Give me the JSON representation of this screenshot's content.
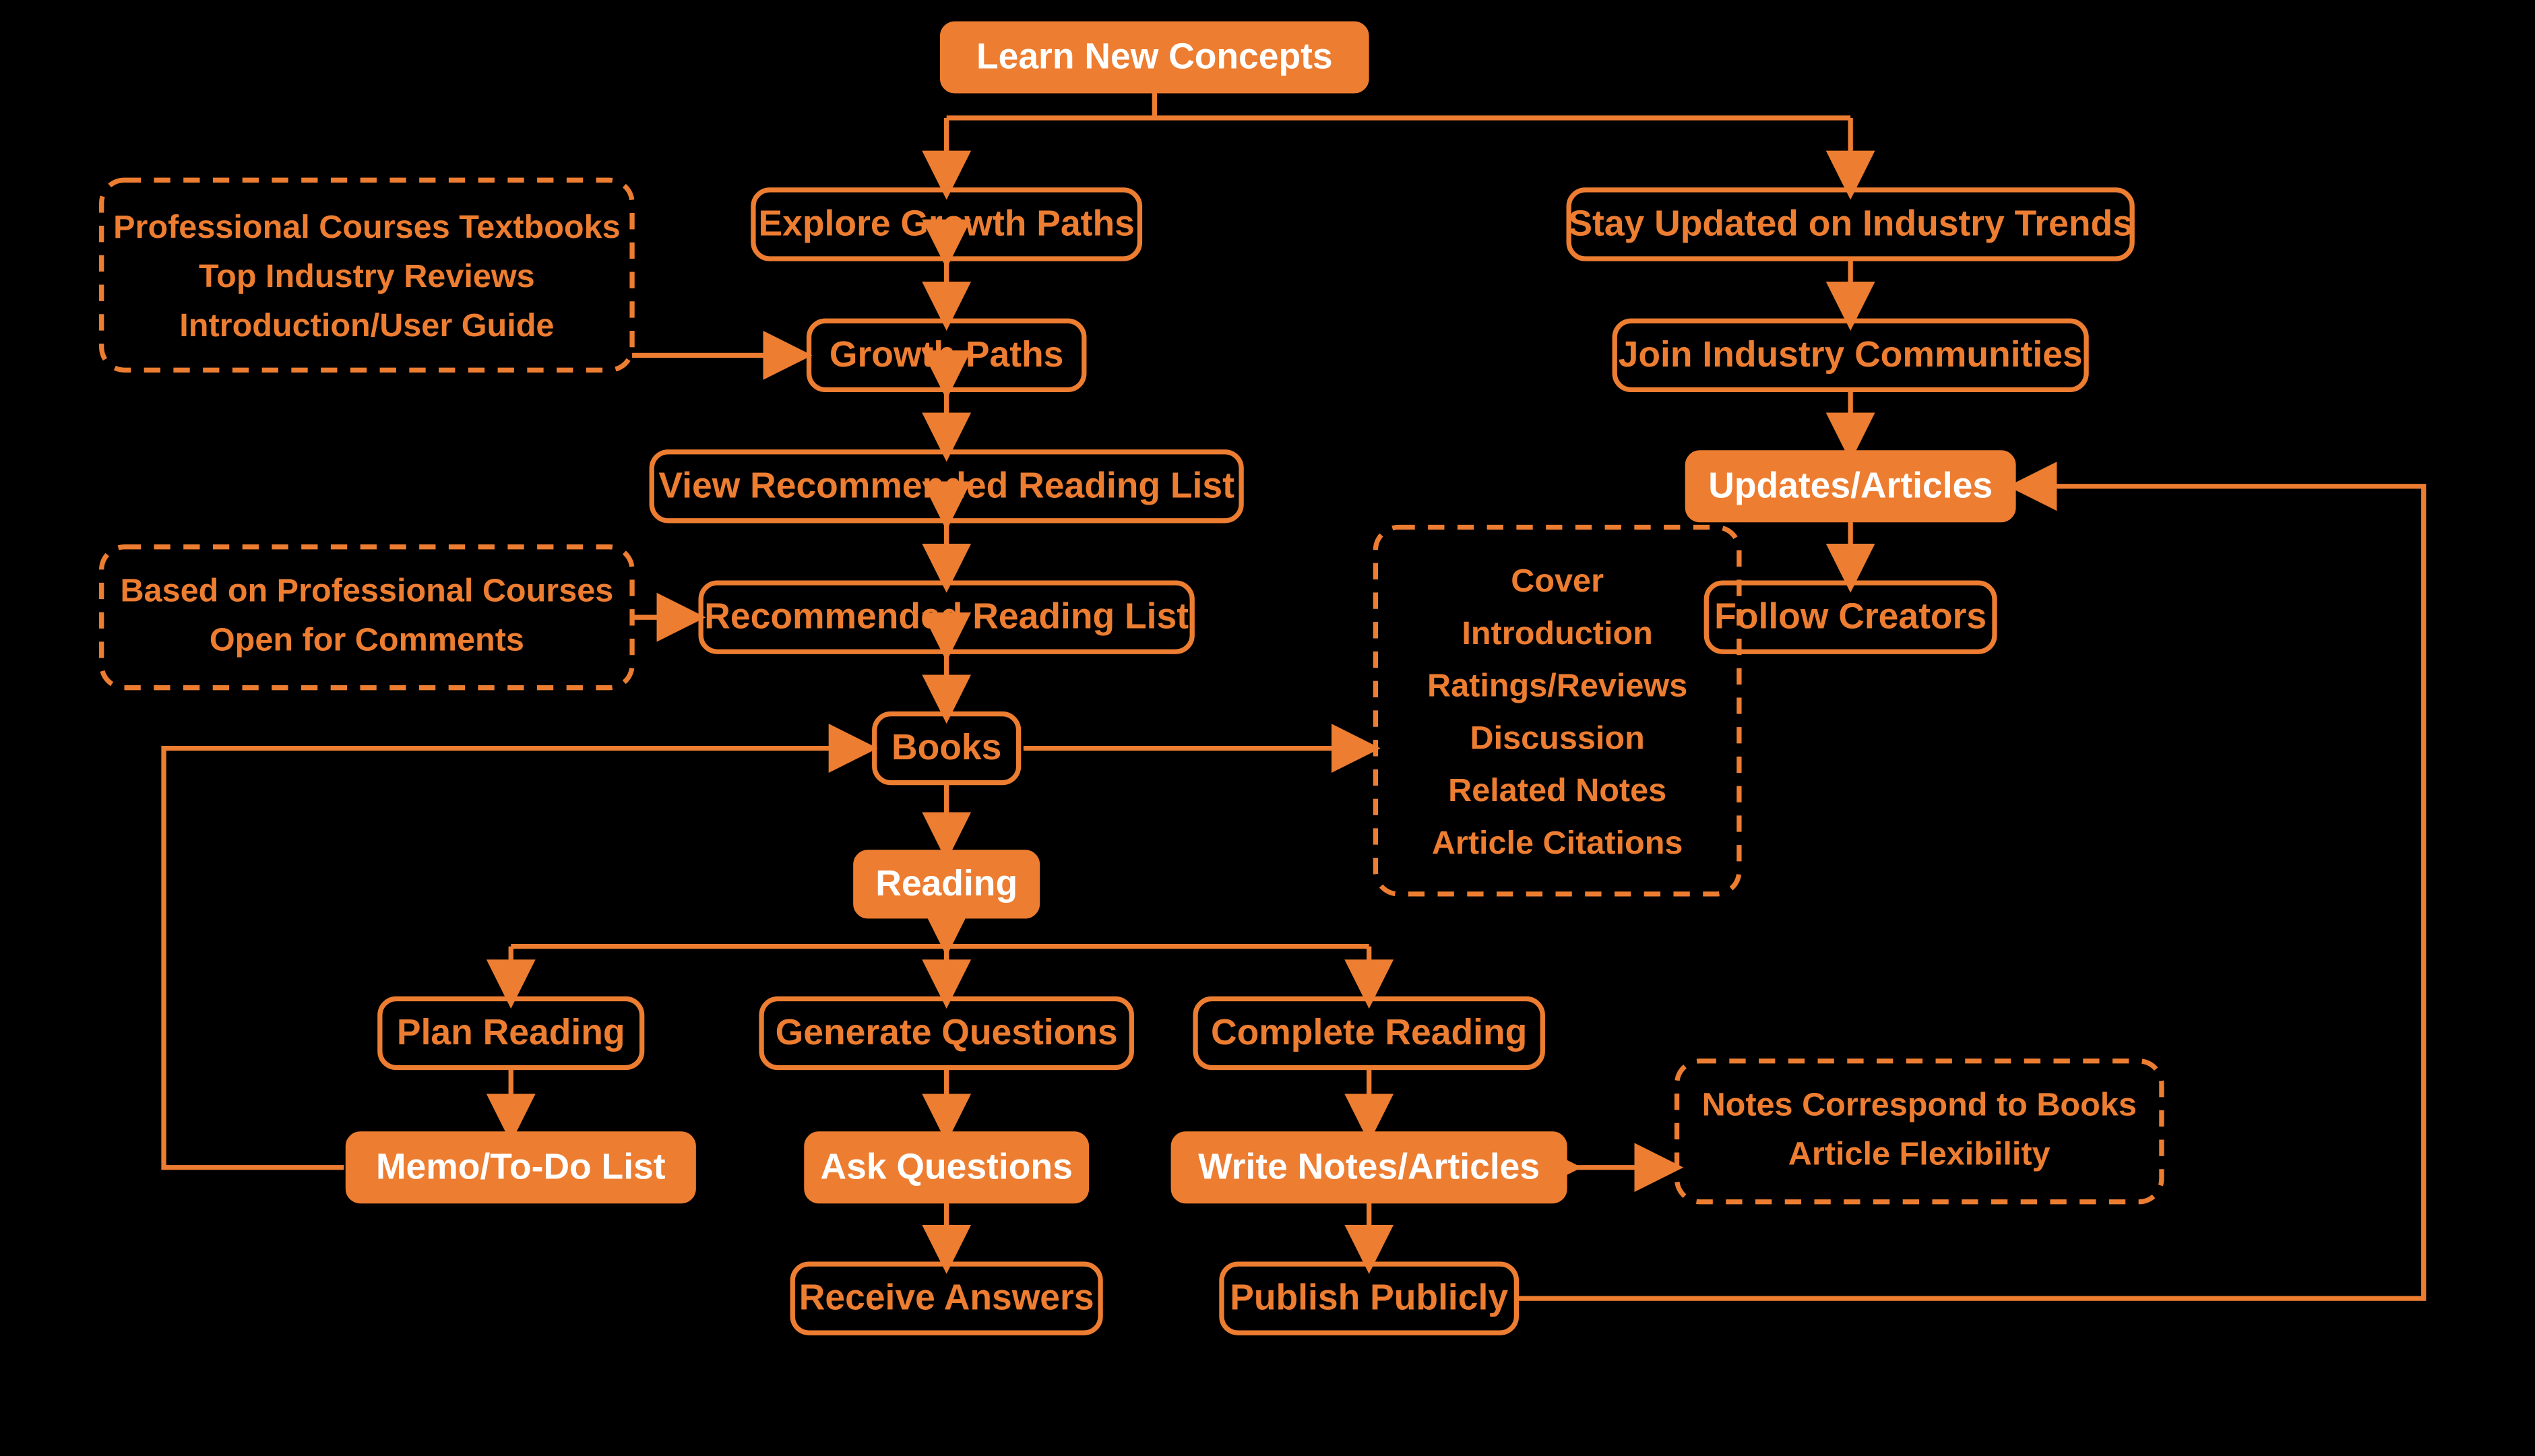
{
  "colors": {
    "accent": "#ED7D31",
    "bg": "#000000",
    "solidText": "#FFFFFF"
  },
  "nodes": {
    "learn": "Learn New Concepts",
    "exploreGrowth": "Explore Growth Paths",
    "growthPaths": "Growth Paths",
    "viewReading": "View Recommended Reading List",
    "recReading": "Recommended Reading List",
    "books": "Books",
    "reading": "Reading",
    "planReading": "Plan Reading",
    "genQuestions": "Generate Questions",
    "completeReading": "Complete Reading",
    "memo": "Memo/To-Do List",
    "askQuestions": "Ask Questions",
    "writeNotes": "Write Notes/Articles",
    "receiveAnswers": "Receive Answers",
    "publish": "Publish Publicly",
    "stayUpdated": "Stay Updated on Industry Trends",
    "joinCommunities": "Join Industry Communities",
    "updatesArticles": "Updates/Articles",
    "followCreators": "Follow Creators"
  },
  "notes": {
    "growth": [
      "Professional Courses Textbooks",
      "Top Industry Reviews",
      "Introduction/User Guide"
    ],
    "reading": [
      "Based on Professional Courses",
      "Open for Comments"
    ],
    "books": [
      "Cover",
      "Introduction",
      "Ratings/Reviews",
      "Discussion",
      "Related Notes",
      "Article Citations"
    ],
    "notes": [
      "Notes Correspond to Books",
      "Article Flexibility"
    ]
  }
}
